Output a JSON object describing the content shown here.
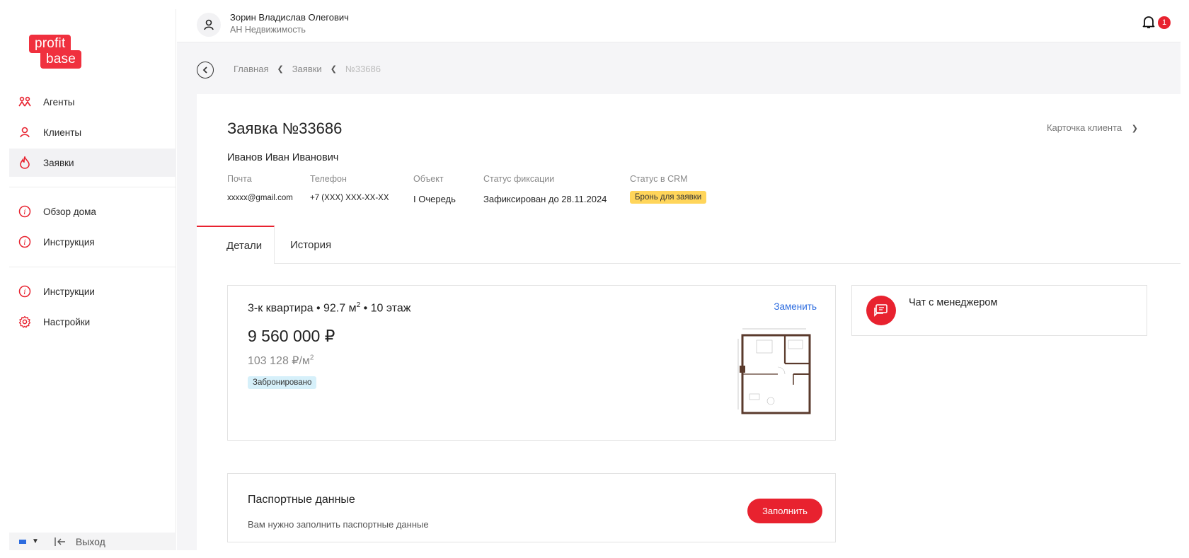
{
  "logo": {
    "line1": "profit",
    "line2": "base"
  },
  "sidebar": {
    "items": [
      {
        "label": "Агенты",
        "icon": "agents-icon"
      },
      {
        "label": "Клиенты",
        "icon": "user-icon"
      },
      {
        "label": "Заявки",
        "icon": "flame-icon",
        "active": true
      },
      {
        "label": "Обзор дома",
        "icon": "info-icon"
      },
      {
        "label": "Инструкция",
        "icon": "info-icon"
      },
      {
        "label": "Инструкции",
        "icon": "info-icon"
      },
      {
        "label": "Настройки",
        "icon": "gear-icon"
      }
    ],
    "logout_label": "Выход"
  },
  "header": {
    "user_name": "Зорин Владислав Олегович",
    "user_org": "АН Недвижимость",
    "notifications_count": "1"
  },
  "breadcrumbs": [
    "Главная",
    "Заявки",
    "№33686"
  ],
  "request": {
    "title": "Заявка №33686",
    "client_card_label": "Карточка клиента",
    "client_name": "Иванов Иван Иванович",
    "fields": {
      "email_label": "Почта",
      "email_value": "xxxxx@gmail.com",
      "phone_label": "Телефон",
      "phone_value": "+7 (XXX) XXX-XX-XX",
      "object_label": "Объект",
      "object_value": "I Очередь",
      "fix_label": "Статус фиксации",
      "fix_value": "Зафиксирован до 28.11.2024",
      "crm_label": "Статус в CRM",
      "crm_value": "Бронь для заявки"
    }
  },
  "tabs": [
    {
      "label": "Детали",
      "active": true
    },
    {
      "label": "История"
    }
  ],
  "apartment": {
    "title_main": "3-к квартира • 92.7 м",
    "title_sup": "2",
    "title_tail": " • 10 этаж",
    "price": "9 560 000 ₽",
    "price_per_sqm": "103 128 ₽/м",
    "price_per_sqm_sup": "2",
    "status": "Забронировано",
    "replace_label": "Заменить"
  },
  "chat": {
    "label": "Чат с менеджером"
  },
  "passport": {
    "title": "Паспортные данные",
    "description": "Вам нужно заполнить паспортные данные",
    "button_label": "Заполнить"
  },
  "colors": {
    "accent": "#e8222f",
    "link": "#2d6cdf",
    "crm_badge": "#ffd55a",
    "status_badge": "#d6f0fa"
  }
}
